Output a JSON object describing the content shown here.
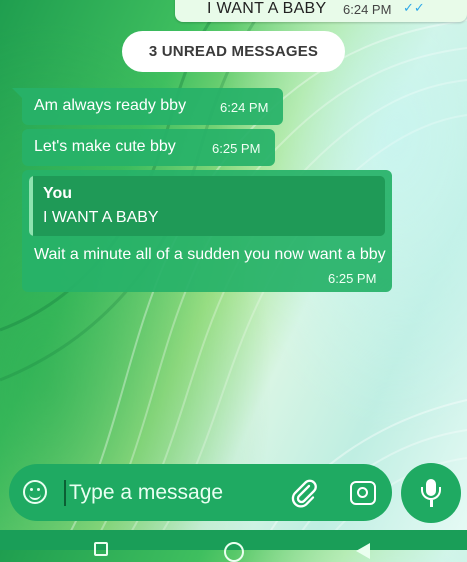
{
  "chat": {
    "previous_outgoing": {
      "text": "I WANT A BABY",
      "time": "6:24 PM",
      "ticks": "✓✓"
    },
    "unread_banner": "3 UNREAD MESSAGES",
    "messages": [
      {
        "text": "Am always ready bby",
        "time": "6:24 PM"
      },
      {
        "text": "Let's make cute bby",
        "time": "6:25 PM"
      },
      {
        "quote": {
          "author": "You",
          "text": "I WANT A BABY"
        },
        "text": "Wait a minute all of a sudden you now want a bby",
        "time": "6:25 PM"
      }
    ]
  },
  "composer": {
    "placeholder": "Type a message",
    "value": "",
    "icons": [
      "emoji-icon",
      "paperclip-icon",
      "camera-icon",
      "microphone-icon"
    ]
  },
  "nav": {
    "icons": [
      "square-icon",
      "circle-icon",
      "triangle-icon"
    ]
  },
  "colors": {
    "bubble_incoming": "#27b268",
    "quote_bg": "#1f9a57",
    "composer_bg": "#1faa62",
    "tick_read": "#2fa8e8"
  }
}
